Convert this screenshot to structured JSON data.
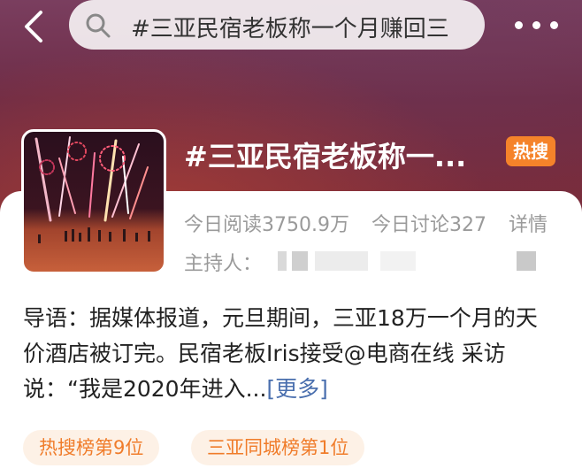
{
  "header": {
    "search_query": "#三亚民宿老板称一个月赚回三",
    "icons": {
      "back": "chevron-left-icon",
      "search": "search-icon",
      "more": "more-dots-icon"
    }
  },
  "topic": {
    "title": "#三亚民宿老板称一...",
    "badge": "热搜",
    "badge_color": "#f5832a",
    "reads": "今日阅读3750.9万",
    "discussions": "今日讨论327",
    "details": "详情",
    "host_label": "主持人："
  },
  "intro": {
    "text": "导语：据媒体报道，元旦期间，三亚18万一个月的天价酒店被订完。民宿老板Iris接受@电商在线 采访说：“我是2020年进入...",
    "more": "[更多]"
  },
  "tags": [
    {
      "label": "热搜榜第9位"
    },
    {
      "label": "三亚同城榜第1位"
    }
  ],
  "colors": {
    "accent_orange": "#f07c2a",
    "link_blue": "#4a6fae",
    "hero_bg": "#6e2c46"
  }
}
